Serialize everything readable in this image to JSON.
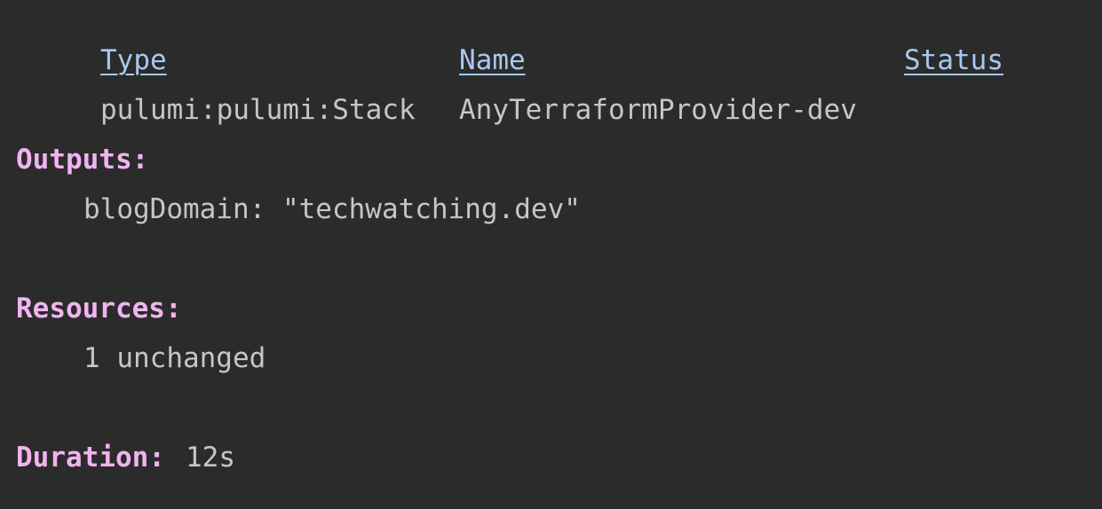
{
  "table": {
    "headers": {
      "type": "Type",
      "name": "Name",
      "status": "Status"
    },
    "rows": [
      {
        "type": "pulumi:pulumi:Stack",
        "name": "AnyTerraformProvider-dev",
        "status": ""
      }
    ]
  },
  "outputs": {
    "label": "Outputs:",
    "items": [
      {
        "text": "blogDomain: \"techwatching.dev\""
      }
    ]
  },
  "resources": {
    "label": "Resources:",
    "items": [
      {
        "text": "1 unchanged"
      }
    ]
  },
  "duration": {
    "label": "Duration:",
    "value": "12s"
  },
  "colors": {
    "background": "#2b2b2b",
    "text": "#c6c6c6",
    "header": "#a8c8f0",
    "section": "#f0b4f0"
  }
}
